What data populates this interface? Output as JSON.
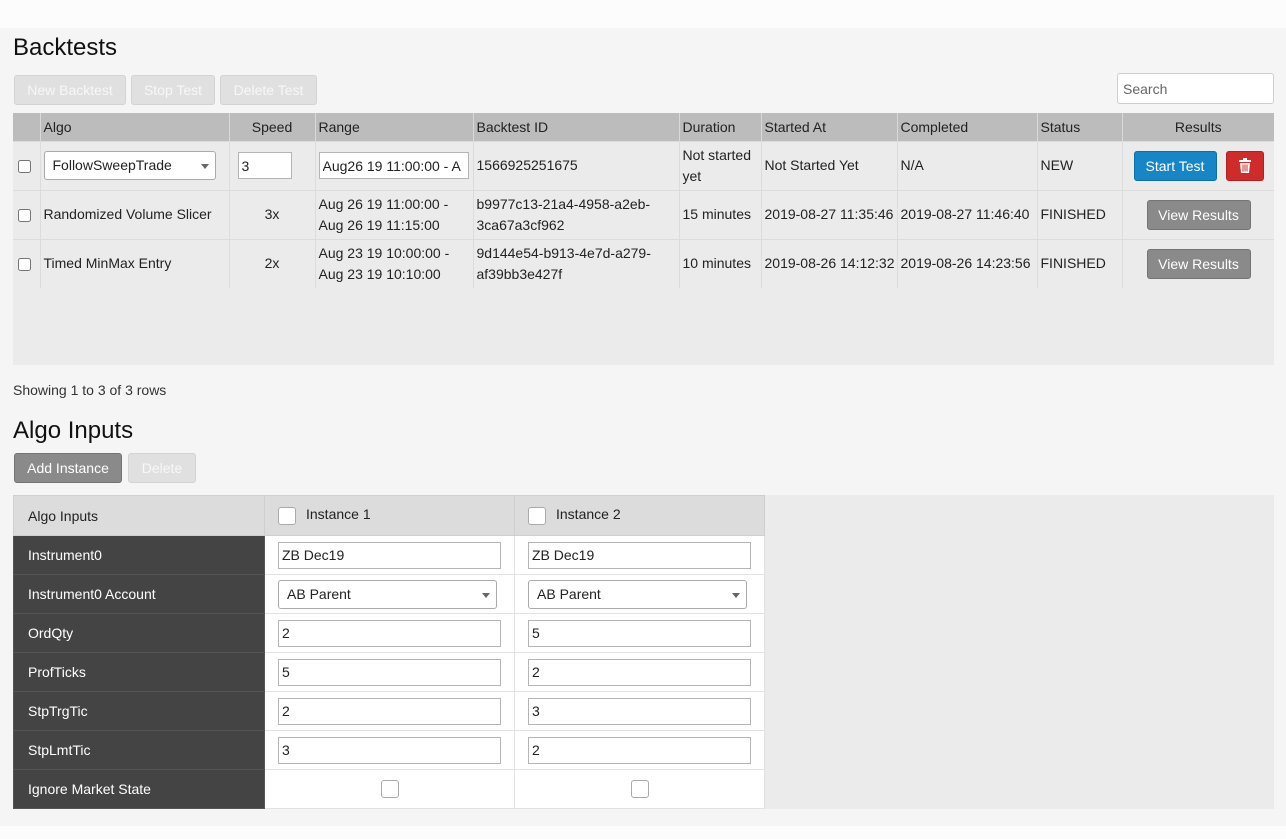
{
  "backtests": {
    "title": "Backtests",
    "toolbar": {
      "new_label": "New Backtest",
      "stop_label": "Stop Test",
      "delete_label": "Delete Test"
    },
    "search": {
      "placeholder": "Search",
      "value": ""
    },
    "columns": [
      "Algo",
      "Speed",
      "Range",
      "Backtest ID",
      "Duration",
      "Started At",
      "Completed",
      "Status",
      "Results"
    ],
    "new_row": {
      "algo": "FollowSweepTrade",
      "speed": "3",
      "range": "Aug26 19 11:00:00 - A",
      "backtest_id": "1566925251675",
      "duration": "Not started yet",
      "started_at": "Not Started Yet",
      "completed": "N/A",
      "status": "NEW",
      "start_label": "Start Test",
      "trash_icon": "trash-icon"
    },
    "rows": [
      {
        "algo": "Randomized Volume Slicer",
        "speed": "3x",
        "range": "Aug 26 19 11:00:00 - Aug 26 19 11:15:00",
        "backtest_id": "b9977c13-21a4-4958-a2eb-3ca67a3cf962",
        "duration": "15 minutes",
        "started_at": "2019-08-27 11:35:46",
        "completed": "2019-08-27 11:46:40",
        "status": "FINISHED",
        "results_label": "View Results"
      },
      {
        "algo": "Timed MinMax Entry",
        "speed": "2x",
        "range": "Aug 23 19 10:00:00 - Aug 23 19 10:10:00",
        "backtest_id": "9d144e54-b913-4e7d-a279-af39bb3e427f",
        "duration": "10 minutes",
        "started_at": "2019-08-26 14:12:32",
        "completed": "2019-08-26 14:23:56",
        "status": "FINISHED",
        "results_label": "View Results"
      }
    ],
    "rows_info": "Showing 1 to 3 of 3 rows"
  },
  "algo_inputs": {
    "title": "Algo Inputs",
    "add_label": "Add Instance",
    "delete_label": "Delete",
    "header_label": "Algo Inputs",
    "instances": [
      "Instance 1",
      "Instance 2"
    ],
    "params": [
      {
        "name": "Instrument0",
        "type": "text",
        "values": [
          "ZB Dec19",
          "ZB Dec19"
        ]
      },
      {
        "name": "Instrument0 Account",
        "type": "select",
        "values": [
          "AB Parent",
          "AB Parent"
        ]
      },
      {
        "name": "OrdQty",
        "type": "text",
        "values": [
          "2",
          "5"
        ]
      },
      {
        "name": "ProfTicks",
        "type": "text",
        "values": [
          "5",
          "2"
        ]
      },
      {
        "name": "StpTrgTic",
        "type": "text",
        "values": [
          "2",
          "3"
        ]
      },
      {
        "name": "StpLmtTic",
        "type": "text",
        "values": [
          "3",
          "2"
        ]
      },
      {
        "name": "Ignore Market State",
        "type": "checkbox",
        "values": [
          false,
          false
        ]
      }
    ]
  }
}
